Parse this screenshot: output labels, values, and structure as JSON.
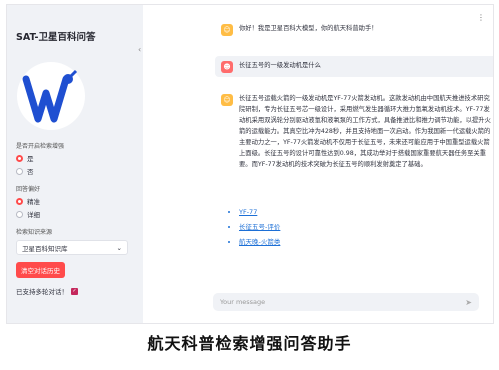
{
  "sidebar": {
    "title": "SAT-卫星百科问答",
    "toggle_label": "是否开启检索增强",
    "toggle_options": [
      "是",
      "否"
    ],
    "answer_label": "回答偏好",
    "answer_options": [
      "精准",
      "详细"
    ],
    "kb_label": "检索知识来源",
    "kb_selected": "卫星百科知识库",
    "clear_button": "清空对话历史",
    "multi_turn_note": "已支持多轮对话！"
  },
  "chat": {
    "greeting": "你好！我是卫星百科大模型，你的航天科普助手！",
    "user_question": "长征五号的一级发动机是什么",
    "answer": "长征五号运载火箭的一级发动机是YF-77火箭发动机。这款发动机由中国航天推进技术研究院研制，专为长征五号芯一级设计，采用燃气发生器循环大推力氢氧发动机技术。YF-77发动机采用双涡轮分别驱动液氢和液氧泵的工作方式，具备推进比和推力调节功能，以提升火箭的运载能力。其真空比冲为428秒，并且支持地面一次启动。作为我国新一代运载火箭的主要动力之一，YF-77火箭发动机不仅用于长征五号，未来还可能应用于中国重型运载火箭上面级。长征五号的设计可靠性达到0.98，其成功举对于搭载国家重要航天器任务至关重要。而YF-77发动机的技术突破为长征五号的顺利发射奠定了基础。",
    "references": [
      "YF-77",
      "长征五号-评价",
      "航天晚-火箭类"
    ],
    "input_placeholder": "Your message"
  },
  "caption": "航天科普检索增强问答助手",
  "colors": {
    "accent": "#ff4b4b",
    "sidebar_bg": "#f0f2f6",
    "link": "#1c6fd6"
  }
}
